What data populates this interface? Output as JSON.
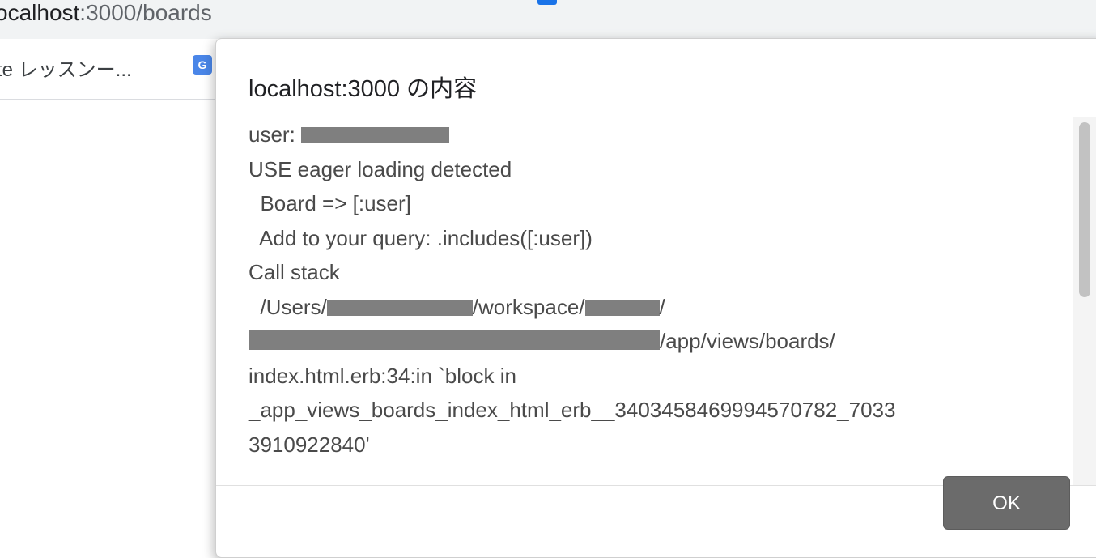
{
  "browser": {
    "url_host": "ocalhost",
    "url_path": ":3000/boards",
    "bookmarks": [
      {
        "label": "te レッスンー..."
      }
    ],
    "bookmark_icon_glyph": "G"
  },
  "dialog": {
    "title": "localhost:3000 の内容",
    "message_lines": {
      "l0": "user: ",
      "l1": "USE eager loading detected",
      "l2": "  Board => [:user]",
      "l3": "  Add to your query: .includes([:user])",
      "l4": "Call stack",
      "l5a": "  /Users/",
      "l5b": "/workspace/",
      "l5c": "/",
      "l6": "/app/views/boards/",
      "l7": "index.html.erb:34:in `block in",
      "l8": "_app_views_boards_index_html_erb__3403458469994570782_7033",
      "l9": "3910922840'"
    },
    "ok_label": "OK"
  }
}
